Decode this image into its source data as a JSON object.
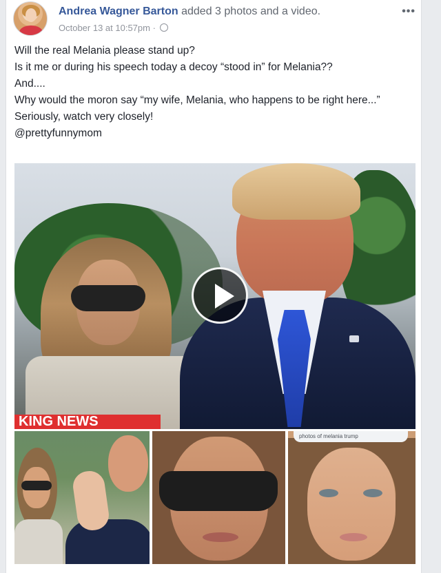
{
  "post": {
    "author": "Andrea Wagner Barton",
    "activity": "added 3 photos and a video.",
    "timestamp": "October 13 at 10:57pm",
    "more_menu_label": "•••",
    "lines": [
      "Will the real Melania please stand up?",
      "Is it me or during his speech today a decoy “stood in” for Melania??",
      "And....",
      "Why would the moron say “my wife, Melania, who happens to be right here...”",
      "Seriously, watch very closely!",
      "@prettyfunnymom"
    ],
    "media": {
      "hero_caption": "KING NEWS",
      "thumb3_banner": "photos of melania trump"
    }
  },
  "icons": {
    "menu": "more-icon",
    "privacy": "globe-icon",
    "video": "play-icon"
  }
}
